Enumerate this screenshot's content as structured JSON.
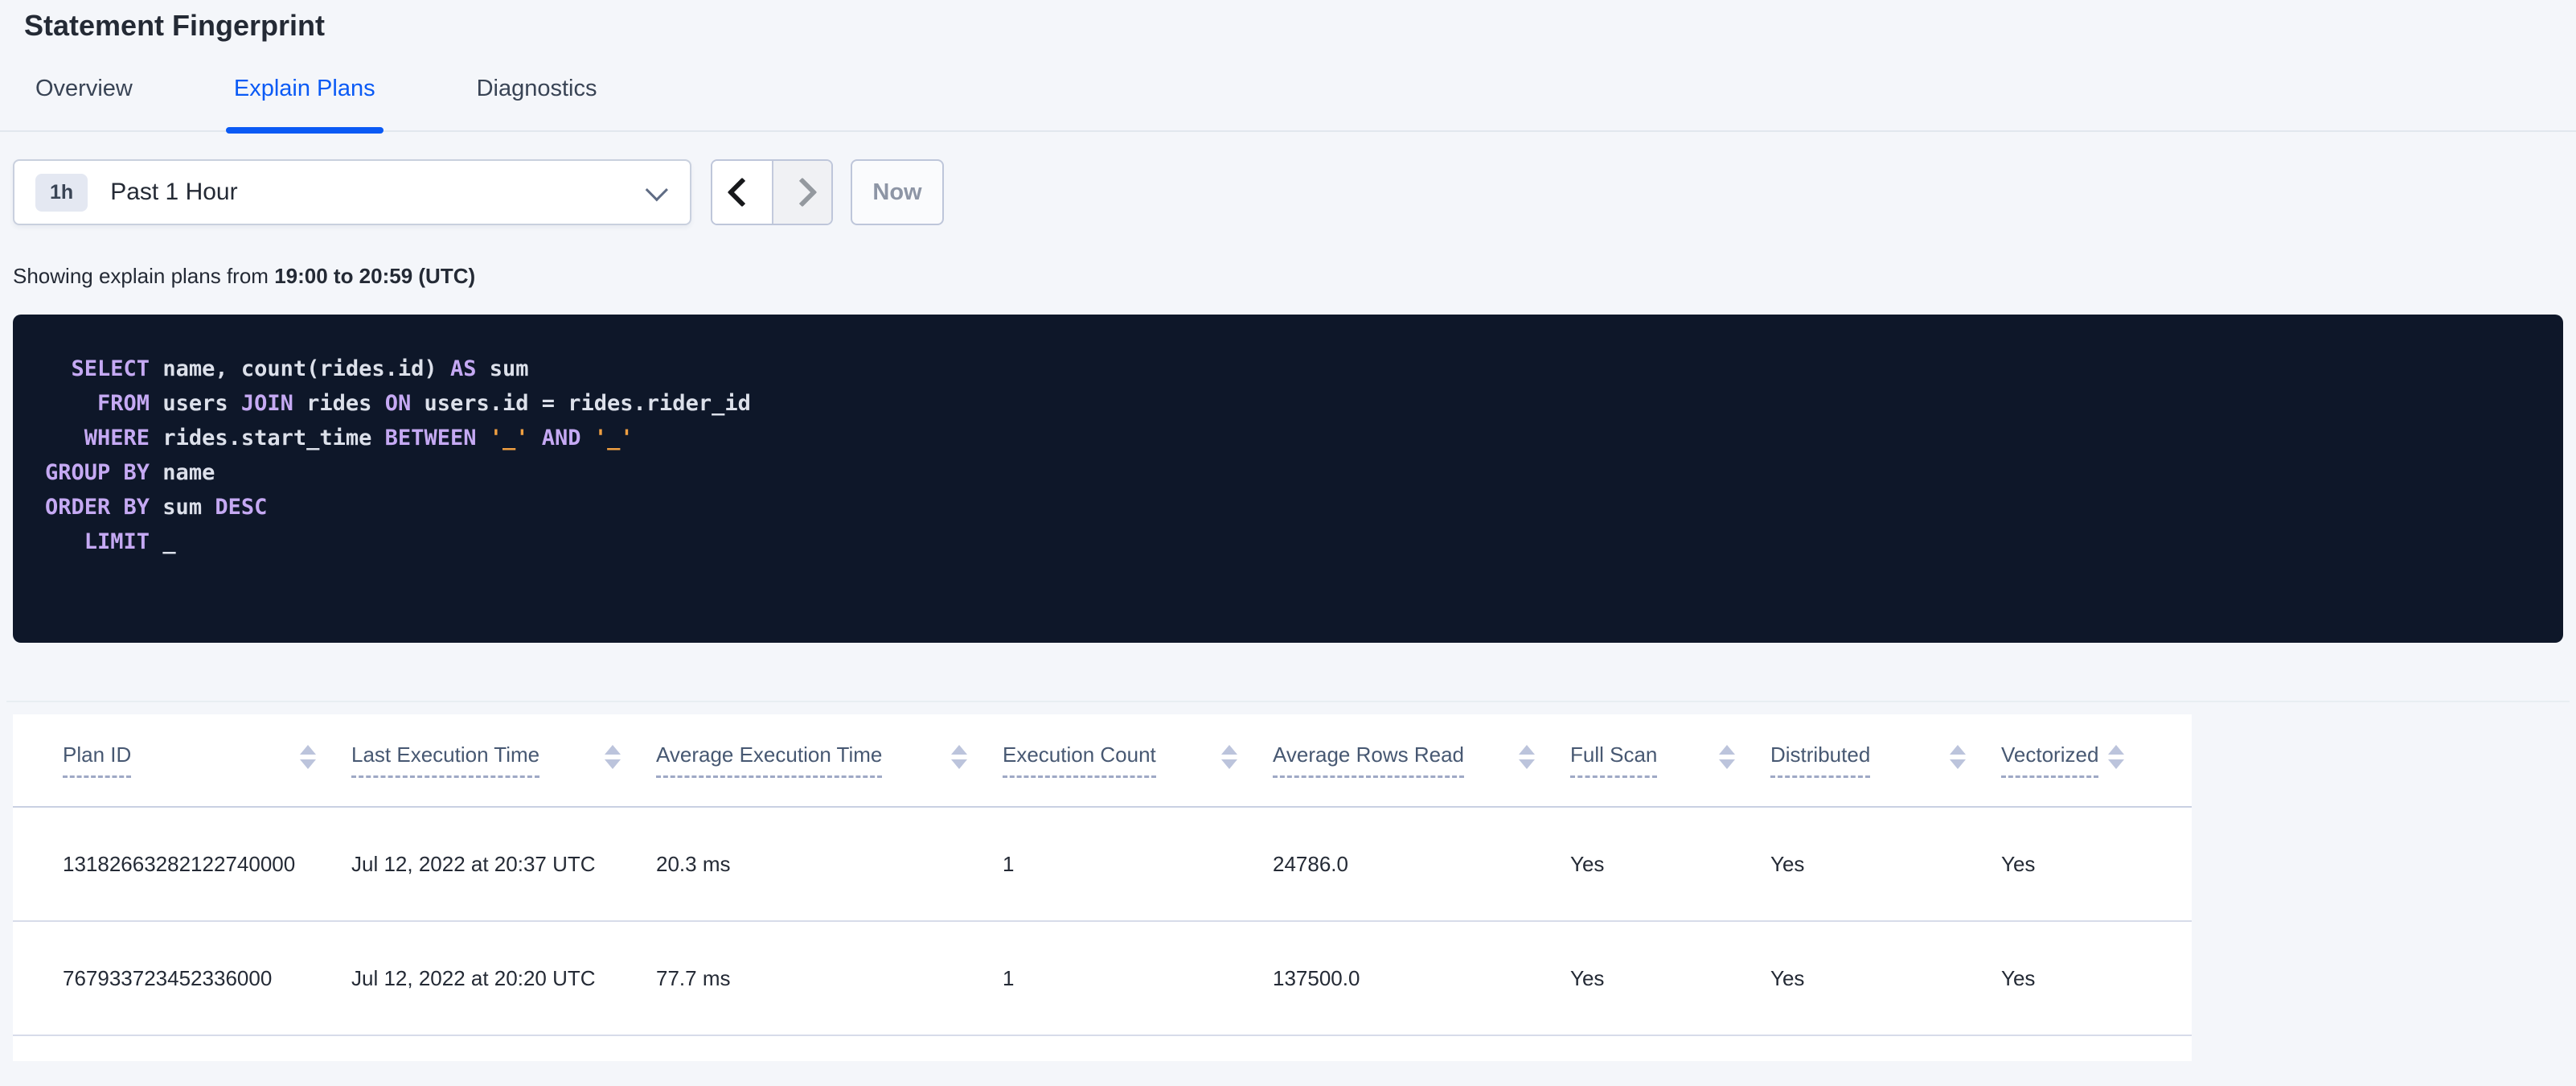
{
  "page": {
    "title": "Statement Fingerprint"
  },
  "tabs": [
    {
      "label": "Overview",
      "active": false
    },
    {
      "label": "Explain Plans",
      "active": true
    },
    {
      "label": "Diagnostics",
      "active": false
    }
  ],
  "time_controls": {
    "duration_badge": "1h",
    "selected_range": "Past 1 Hour",
    "now_label": "Now",
    "prev_enabled": true,
    "next_enabled": false
  },
  "status_line": {
    "prefix": "Showing explain plans from ",
    "range": "19:00 to 20:59 (UTC)"
  },
  "sql": {
    "lines": [
      [
        {
          "t": "plain",
          "s": "  "
        },
        {
          "t": "kw",
          "s": "SELECT"
        },
        {
          "t": "plain",
          "s": " name, count(rides.id) "
        },
        {
          "t": "kw",
          "s": "AS"
        },
        {
          "t": "plain",
          "s": " sum"
        }
      ],
      [
        {
          "t": "plain",
          "s": "    "
        },
        {
          "t": "kw",
          "s": "FROM"
        },
        {
          "t": "plain",
          "s": " users "
        },
        {
          "t": "kw",
          "s": "JOIN"
        },
        {
          "t": "plain",
          "s": " rides "
        },
        {
          "t": "kw",
          "s": "ON"
        },
        {
          "t": "plain",
          "s": " users.id = rides.rider_id"
        }
      ],
      [
        {
          "t": "plain",
          "s": "   "
        },
        {
          "t": "kw",
          "s": "WHERE"
        },
        {
          "t": "plain",
          "s": " rides.start_time "
        },
        {
          "t": "kw",
          "s": "BETWEEN"
        },
        {
          "t": "plain",
          "s": " "
        },
        {
          "t": "lit",
          "s": "'_'"
        },
        {
          "t": "plain",
          "s": " "
        },
        {
          "t": "kw",
          "s": "AND"
        },
        {
          "t": "plain",
          "s": " "
        },
        {
          "t": "lit",
          "s": "'_'"
        }
      ],
      [
        {
          "t": "kw",
          "s": "GROUP BY"
        },
        {
          "t": "plain",
          "s": " name"
        }
      ],
      [
        {
          "t": "kw",
          "s": "ORDER BY"
        },
        {
          "t": "plain",
          "s": " sum "
        },
        {
          "t": "kw",
          "s": "DESC"
        }
      ],
      [
        {
          "t": "plain",
          "s": "   "
        },
        {
          "t": "kw",
          "s": "LIMIT"
        },
        {
          "t": "plain",
          "s": " _"
        }
      ]
    ]
  },
  "plans_table": {
    "columns": [
      "Plan ID",
      "Last Execution Time",
      "Average Execution Time",
      "Execution Count",
      "Average Rows Read",
      "Full Scan",
      "Distributed",
      "Vectorized"
    ],
    "rows": [
      [
        "13182663282122740000",
        "Jul 12, 2022 at 20:37 UTC",
        "20.3 ms",
        "1",
        "24786.0",
        "Yes",
        "Yes",
        "Yes"
      ],
      [
        "767933723452336000",
        "Jul 12, 2022 at 20:20 UTC",
        "77.7 ms",
        "1",
        "137500.0",
        "Yes",
        "Yes",
        "Yes"
      ]
    ]
  },
  "colors": {
    "accent_blue": "#0a5af5",
    "page_background": "#f4f6fa",
    "code_background": "#0e1729",
    "code_keyword": "#c5a9f3",
    "code_text": "#dce0ea",
    "code_literal": "#ef9f41",
    "header_text": "#475872",
    "cell_text": "#242a35"
  }
}
